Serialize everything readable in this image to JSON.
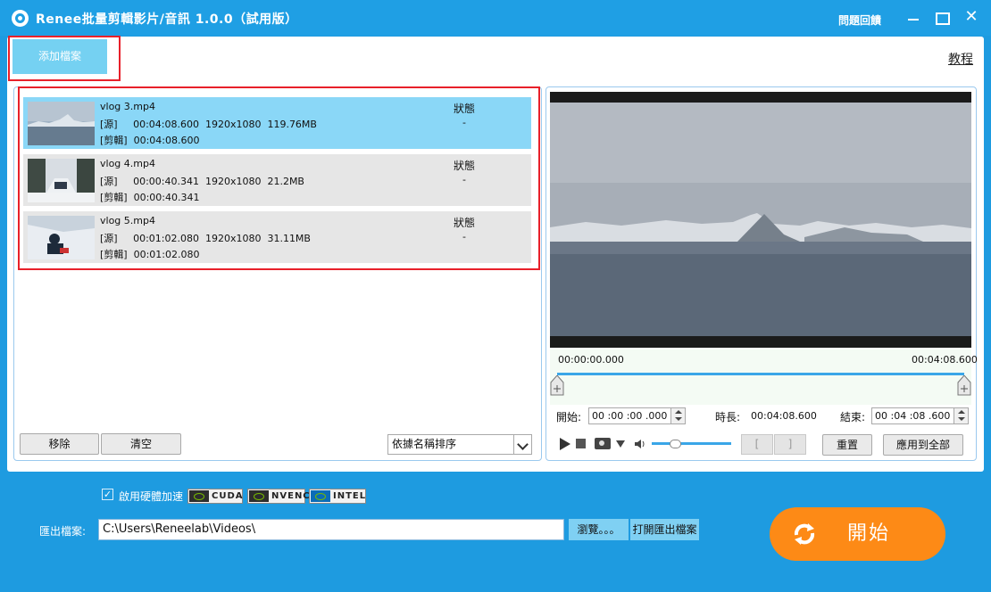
{
  "window": {
    "title": "Renee批量剪輯影片/音訊 1.0.0（試用版）",
    "feedback": "問題回饋",
    "close_glyph": "✕"
  },
  "toolbar": {
    "add_file_label": "添加檔案",
    "tutorial_label": "教程"
  },
  "file_list": {
    "status_header": "狀態",
    "items": [
      {
        "name": "vlog 3.mp4",
        "source_line": "[源]     00:04:08.600  1920x1080  119.76MB",
        "clip_line": "[剪輯]  00:04:08.600",
        "status": "-",
        "selected": true
      },
      {
        "name": "vlog 4.mp4",
        "source_line": "[源]     00:00:40.341  1920x1080  21.2MB",
        "clip_line": "[剪輯]  00:00:40.341",
        "status": "-",
        "selected": false
      },
      {
        "name": "vlog 5.mp4",
        "source_line": "[源]     00:01:02.080  1920x1080  31.11MB",
        "clip_line": "[剪輯]  00:01:02.080",
        "status": "-",
        "selected": false
      }
    ],
    "remove_label": "移除",
    "clear_label": "清空",
    "sort_selected": "依據名稱排序"
  },
  "preview": {
    "time_start": "00:00:00.000",
    "time_end": "00:04:08.600",
    "start_label": "開始:",
    "start_value": "00 :00 :00 .000",
    "duration_label": "時長:",
    "duration_value": "00:04:08.600",
    "end_label": "結束:",
    "end_value": "00 :04 :08 .600",
    "bracket_in": "[",
    "bracket_out": "]",
    "reset_label": "重置",
    "apply_all_label": "應用到全部",
    "volume_level": 0.3
  },
  "bottom": {
    "hw_accel_label": "啟用硬體加速",
    "hw_checked": "✓",
    "chips": [
      "CUDA",
      "NVENC",
      "INTEL"
    ],
    "output_label": "匯出檔案:",
    "output_path": "C:\\Users\\Reneelab\\Videos\\",
    "browse_label": "瀏覽。。。",
    "open_folder_label": "打開匯出檔案",
    "start_label": "開始"
  },
  "colors": {
    "accent": "#1e9be0",
    "selected_row": "#8ad7f7",
    "start_button": "#fd8a16",
    "highlight_box": "#e8202a"
  }
}
